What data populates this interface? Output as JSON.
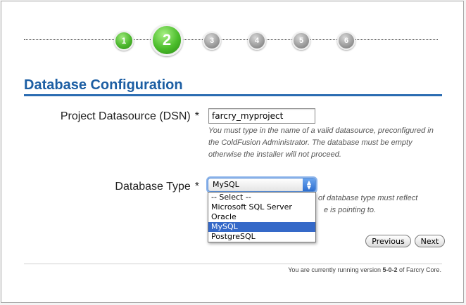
{
  "steps": [
    {
      "label": "1",
      "state": "done"
    },
    {
      "label": "2",
      "state": "current"
    },
    {
      "label": "3",
      "state": "todo"
    },
    {
      "label": "4",
      "state": "todo"
    },
    {
      "label": "5",
      "state": "todo"
    },
    {
      "label": "6",
      "state": "todo"
    }
  ],
  "heading": "Database Configuration",
  "dsn": {
    "label": "Project Datasource (DSN)",
    "required_mark": "*",
    "value": "farcry_myproject",
    "hint": "You must type in the name of a valid datasource, preconfigured in the ColdFusion Administrator. The database must be empty otherwise the installer will not proceed."
  },
  "db_type": {
    "label": "Database Type",
    "required_mark": "*",
    "selected": "MySQL",
    "options": [
      "-- Select --",
      "Microsoft SQL Server",
      "Oracle",
      "MySQL",
      "PostgreSQL"
    ],
    "hint_line1": "of database type must reflect",
    "hint_line2": "e is pointing to."
  },
  "buttons": {
    "previous": "Previous",
    "next": "Next"
  },
  "footer": {
    "prefix": "You are currently running version ",
    "version": "5-0-2",
    "suffix": " of Farcry Core."
  },
  "colors": {
    "heading": "#1c5ea3",
    "step_active": "#4cb72e",
    "step_pending": "#9a9a9a",
    "selected_option": "#3569c8"
  }
}
